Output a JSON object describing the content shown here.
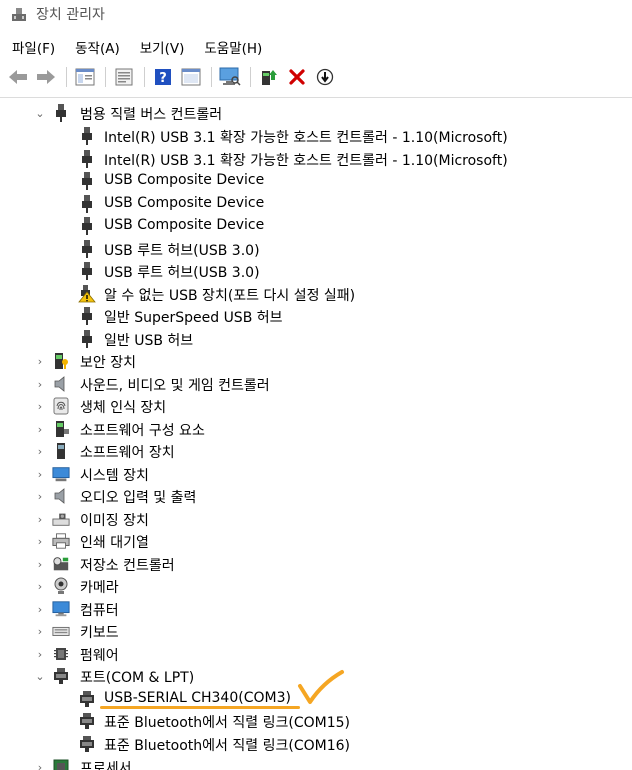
{
  "window": {
    "title": "장치 관리자"
  },
  "menu": [
    "파일(F)",
    "동작(A)",
    "보기(V)",
    "도움말(H)"
  ],
  "toolbar": [
    {
      "name": "back-icon"
    },
    {
      "name": "forward-icon"
    },
    {
      "name": "show-hide-tree-icon"
    },
    {
      "name": "properties-icon"
    },
    {
      "name": "help-icon"
    },
    {
      "name": "view-icon"
    },
    {
      "name": "scan-hardware-icon"
    },
    {
      "name": "update-driver-icon"
    },
    {
      "name": "uninstall-icon"
    },
    {
      "name": "disable-icon"
    }
  ],
  "tree": {
    "usb_controllers": {
      "label": "범용 직렬 버스 컨트롤러",
      "children": [
        "Intel(R) USB 3.1 확장 가능한 호스트 컨트롤러 - 1.10(Microsoft)",
        "Intel(R) USB 3.1 확장 가능한 호스트 컨트롤러 - 1.10(Microsoft)",
        "USB Composite Device",
        "USB Composite Device",
        "USB Composite Device",
        "USB 루트 허브(USB 3.0)",
        "USB 루트 허브(USB 3.0)",
        "알 수 없는 USB 장치(포트 다시 설정 실패)",
        "일반 SuperSpeed USB 허브",
        "일반 USB 허브"
      ]
    },
    "categories": [
      "보안 장치",
      "사운드, 비디오 및 게임 컨트롤러",
      "생체 인식 장치",
      "소프트웨어 구성 요소",
      "소프트웨어 장치",
      "시스템 장치",
      "오디오 입력 및 출력",
      "이미징 장치",
      "인쇄 대기열",
      "저장소 컨트롤러",
      "카메라",
      "컴퓨터",
      "키보드",
      "펌웨어"
    ],
    "ports": {
      "label": "포트(COM & LPT)",
      "children": [
        "USB-SERIAL CH340(COM3)",
        "표준 Bluetooth에서 직렬 링크(COM15)",
        "표준 Bluetooth에서 직렬 링크(COM16)"
      ]
    },
    "processor": {
      "label": "프로세서"
    }
  },
  "colors": {
    "annotation": "#f5a623",
    "error_red": "#d00000",
    "help_blue": "#2050c0"
  }
}
